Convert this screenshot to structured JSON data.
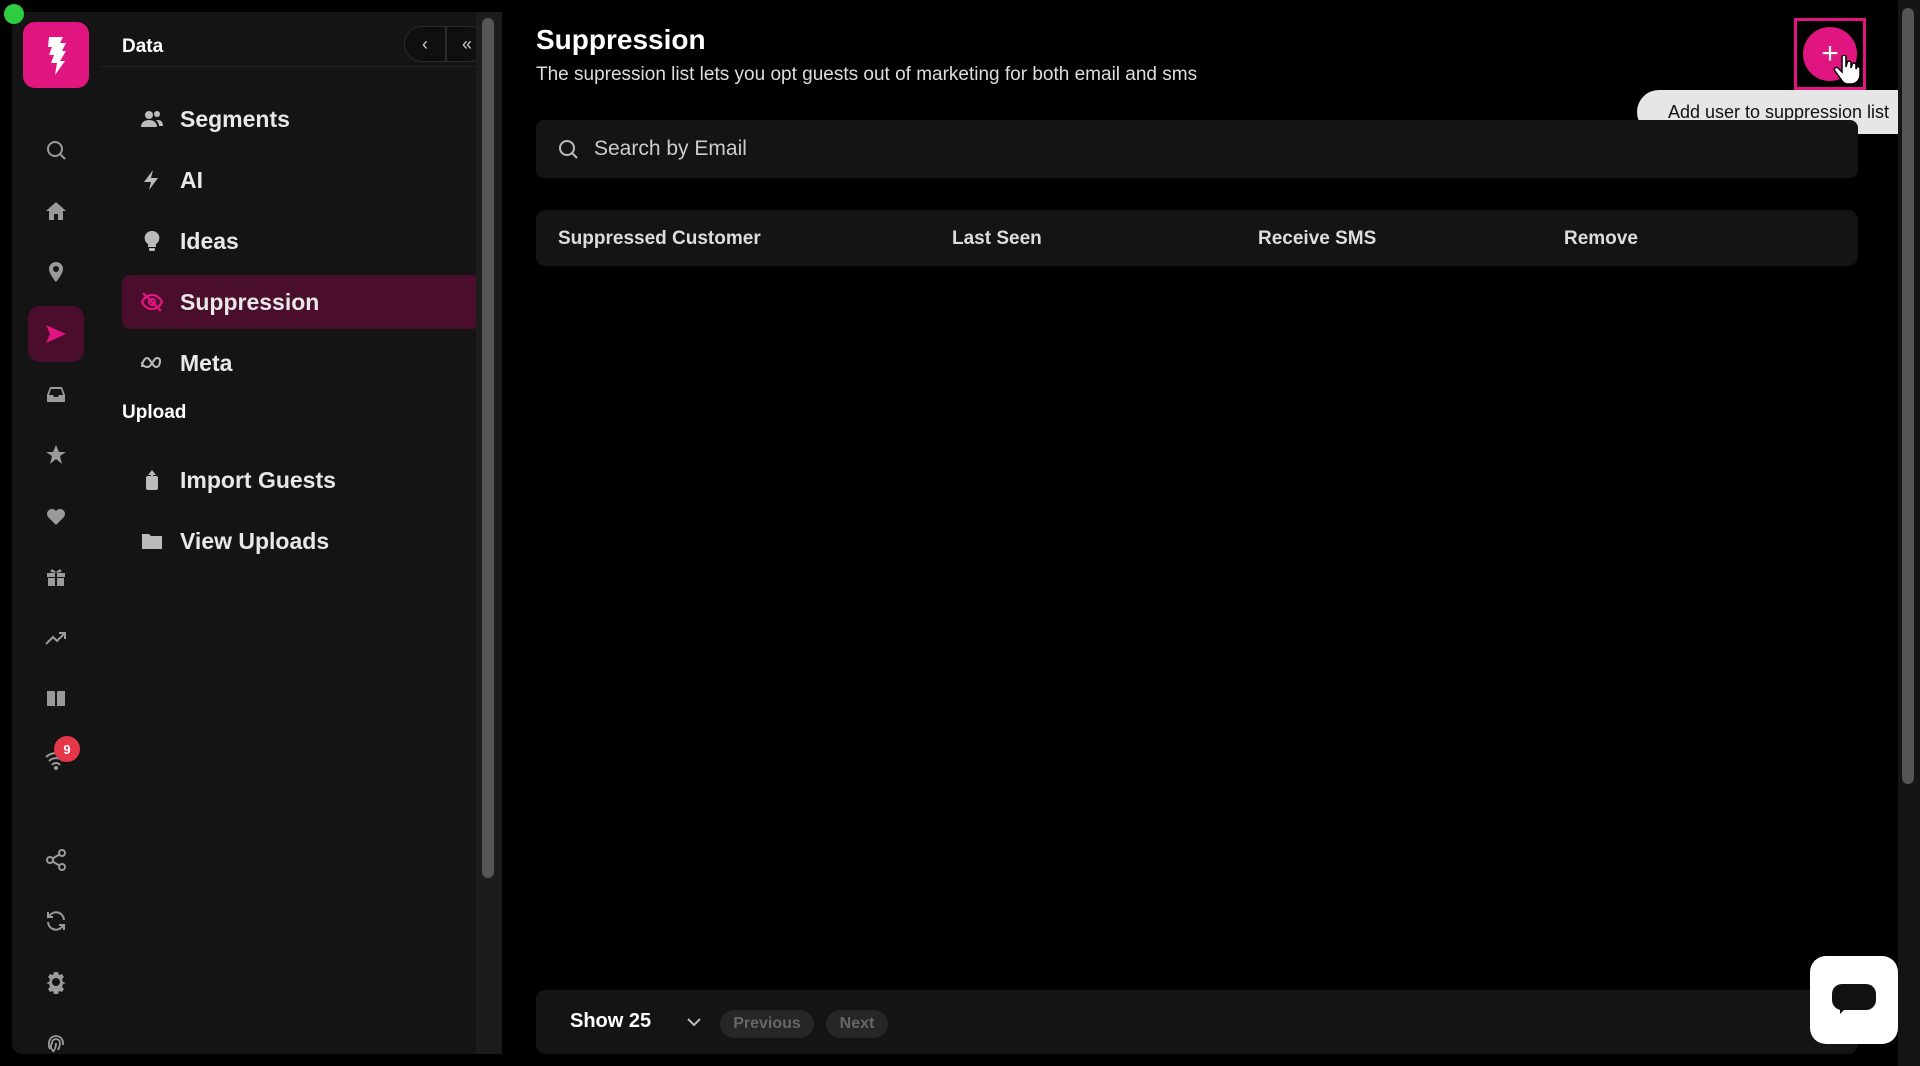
{
  "colors": {
    "accent": "#e0157f",
    "active_bg": "#4a0d2c",
    "panel": "#141414",
    "badge": "#e5364a"
  },
  "rail": {
    "logo_icon": "brand-logo-icon",
    "items": [
      {
        "icon": "search-icon"
      },
      {
        "icon": "home-icon"
      },
      {
        "icon": "location-pin-icon"
      },
      {
        "icon": "send-icon",
        "active": true
      },
      {
        "icon": "inbox-icon"
      },
      {
        "icon": "star-icon"
      },
      {
        "icon": "heart-icon"
      },
      {
        "icon": "gift-icon"
      },
      {
        "icon": "trending-icon"
      },
      {
        "icon": "book-icon"
      },
      {
        "icon": "wifi-icon",
        "badge": "9"
      },
      {
        "icon": "share-icon"
      },
      {
        "icon": "refresh-icon"
      },
      {
        "icon": "gear-icon"
      },
      {
        "icon": "fingerprint-icon"
      }
    ]
  },
  "subnav": {
    "title": "Data",
    "back_label": "‹",
    "collapse_label": "«",
    "items": [
      {
        "label": "Segments",
        "icon": "users-icon"
      },
      {
        "label": "AI",
        "icon": "lightning-icon"
      },
      {
        "label": "Ideas",
        "icon": "lightbulb-icon"
      },
      {
        "label": "Suppression",
        "icon": "eye-off-icon",
        "active": true
      },
      {
        "label": "Meta",
        "icon": "meta-icon"
      }
    ],
    "upload_section": "Upload",
    "upload_items": [
      {
        "label": "Import Guests",
        "icon": "import-icon"
      },
      {
        "label": "View Uploads",
        "icon": "folder-icon"
      }
    ]
  },
  "main": {
    "title": "Suppression",
    "subtitle": "The supression list lets you opt guests out of marketing for both email and sms",
    "add_button": "+",
    "tooltip": "Add user to suppression list",
    "search": {
      "placeholder": "Search by Email",
      "value": ""
    },
    "table": {
      "columns": [
        "Suppressed Customer",
        "Last Seen",
        "Receive SMS",
        "Remove"
      ],
      "rows": []
    },
    "footer": {
      "show_label": "Show 25",
      "previous": "Previous",
      "next": "Next"
    }
  }
}
